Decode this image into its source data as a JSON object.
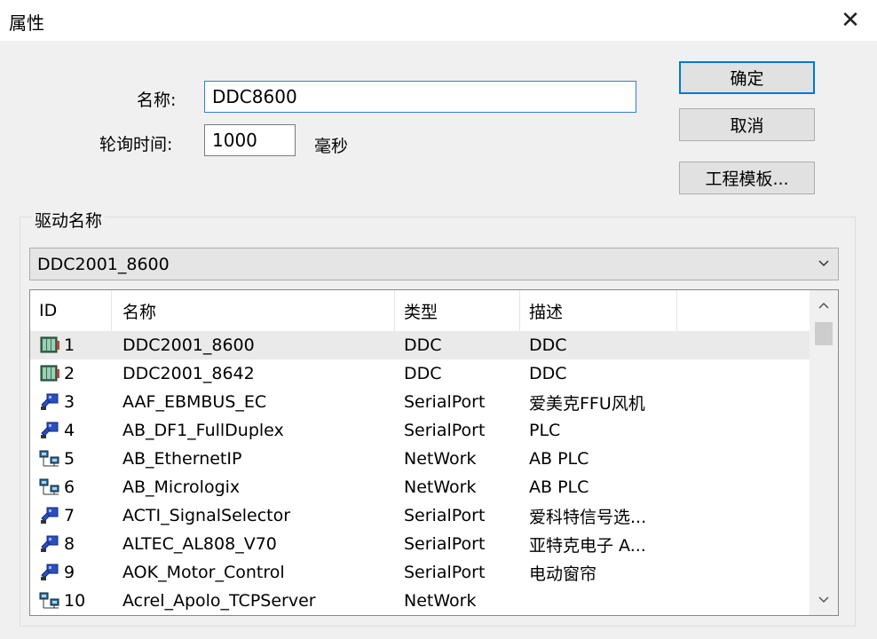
{
  "window": {
    "title": "属性",
    "close_glyph": "✕"
  },
  "form": {
    "name_label": "名称:",
    "name_value": "DDC8600",
    "poll_label": "轮询时间:",
    "poll_value": "1000",
    "poll_unit": "毫秒"
  },
  "buttons": {
    "ok": "确定",
    "cancel": "取消",
    "template": "工程模板..."
  },
  "driver": {
    "group_title": "驱动名称",
    "selected": "DDC2001_8600",
    "columns": [
      "ID",
      "名称",
      "类型",
      "描述"
    ],
    "rows": [
      {
        "icon": "ddc-device-icon",
        "id": "1",
        "name": "DDC2001_8600",
        "type": "DDC",
        "desc": "DDC"
      },
      {
        "icon": "ddc-device-icon",
        "id": "2",
        "name": "DDC2001_8642",
        "type": "DDC",
        "desc": "DDC"
      },
      {
        "icon": "serialport-icon",
        "id": "3",
        "name": "AAF_EBMBUS_EC",
        "type": "SerialPort",
        "desc": "爱美克FFU风机"
      },
      {
        "icon": "serialport-icon",
        "id": "4",
        "name": "AB_DF1_FullDuplex",
        "type": "SerialPort",
        "desc": "PLC"
      },
      {
        "icon": "network-icon",
        "id": "5",
        "name": "AB_EthernetIP",
        "type": "NetWork",
        "desc": "AB PLC"
      },
      {
        "icon": "network-icon",
        "id": "6",
        "name": "AB_Micrologix",
        "type": "NetWork",
        "desc": "AB PLC"
      },
      {
        "icon": "serialport-icon",
        "id": "7",
        "name": "ACTI_SignalSelector",
        "type": "SerialPort",
        "desc": "爱科特信号选..."
      },
      {
        "icon": "serialport-icon",
        "id": "8",
        "name": "ALTEC_AL808_V70",
        "type": "SerialPort",
        "desc": "亚特克电子 A..."
      },
      {
        "icon": "serialport-icon",
        "id": "9",
        "name": "AOK_Motor_Control",
        "type": "SerialPort",
        "desc": "电动窗帘"
      },
      {
        "icon": "network-icon",
        "id": "10",
        "name": "Acrel_Apolo_TCPServer",
        "type": "NetWork",
        "desc": ""
      }
    ]
  },
  "colors": {
    "focus_border": "#2f7fd6",
    "default_button_border": "#0078d7",
    "selected_row": "#eaeaea"
  }
}
